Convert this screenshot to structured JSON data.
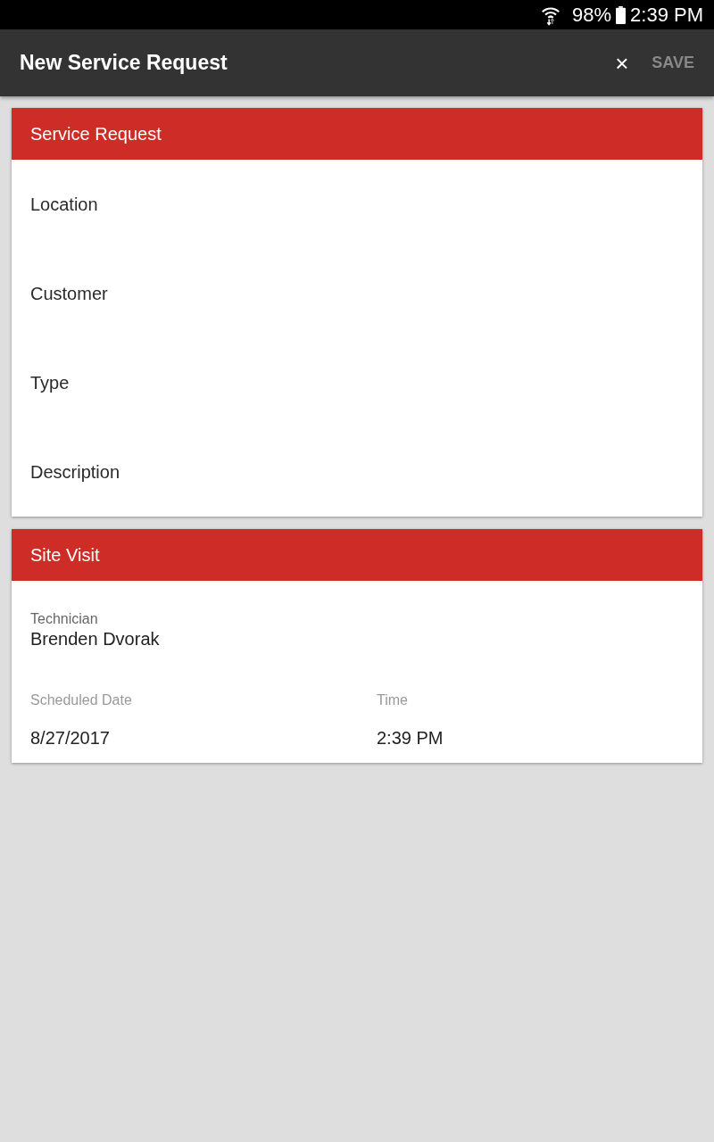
{
  "status_bar": {
    "battery": "98%",
    "time": "2:39 PM"
  },
  "toolbar": {
    "title": "New Service Request",
    "close": "×",
    "save": {
      "label": "SAVE",
      "disabled": true
    }
  },
  "sections": [
    {
      "title": "Service Request",
      "fields": [
        {
          "kind": "input",
          "placeholder": "Location"
        },
        {
          "kind": "input",
          "placeholder": "Customer"
        },
        {
          "kind": "input",
          "placeholder": "Type"
        },
        {
          "kind": "input",
          "placeholder": "Description"
        }
      ]
    },
    {
      "title": "Site Visit",
      "fields": [
        {
          "kind": "labeled",
          "columns": [
            {
              "label": "Technician",
              "value": "Brenden Dvorak"
            }
          ]
        },
        {
          "kind": "split",
          "columns": [
            {
              "label": "Scheduled Date",
              "value": "8/27/2017"
            },
            {
              "label": "Time",
              "value": "2:39 PM"
            }
          ]
        }
      ]
    }
  ]
}
